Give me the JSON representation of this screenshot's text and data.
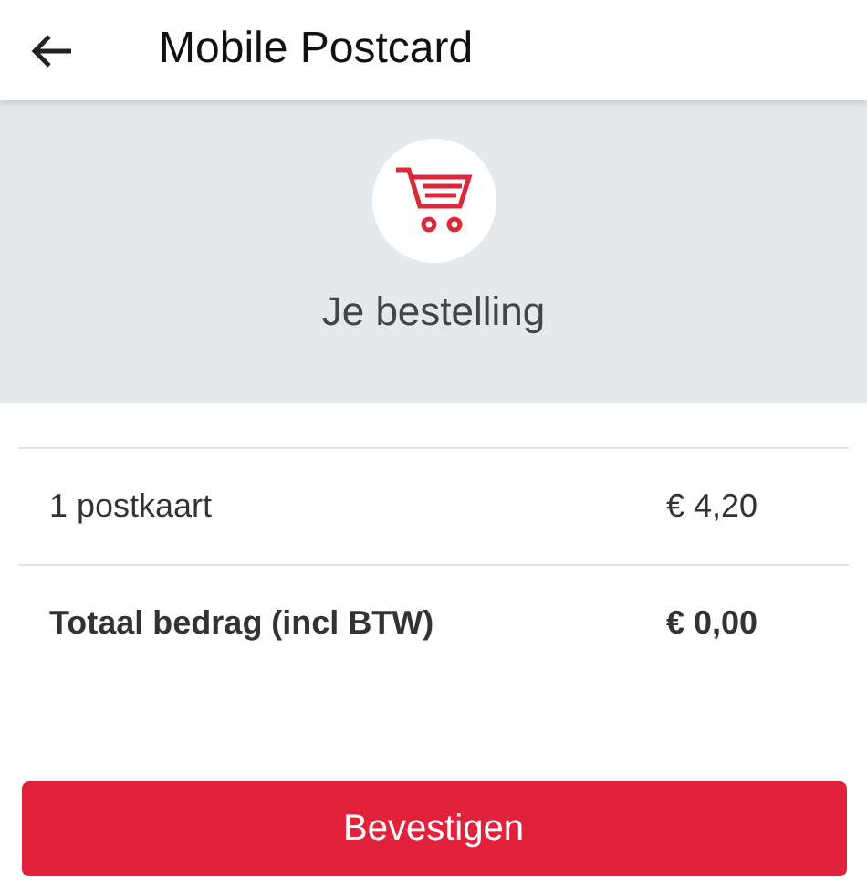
{
  "app_bar": {
    "title": "Mobile Postcard"
  },
  "header": {
    "title": "Je bestelling"
  },
  "rows": [
    {
      "kind": "item",
      "label": "1 postkaart",
      "amount": "€ 4,20"
    },
    {
      "kind": "total",
      "label": "Totaal bedrag (incl BTW)",
      "amount": "€ 0,00"
    }
  ],
  "button": {
    "label": "Bevestigen"
  }
}
